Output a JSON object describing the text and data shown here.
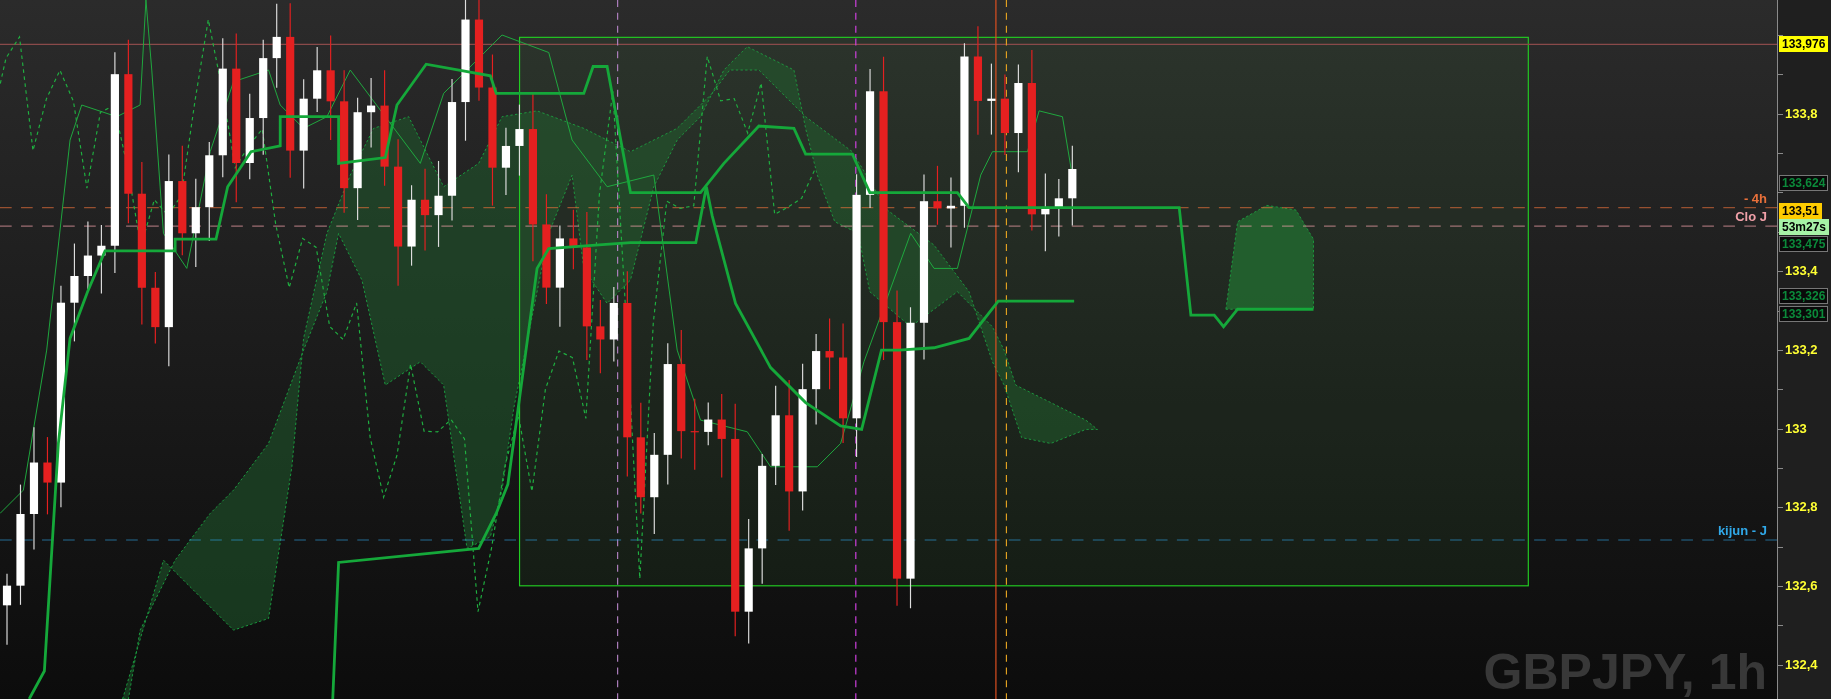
{
  "chart": {
    "symbol": "GBPJPY, 1h",
    "axis_labels": [
      "133,8",
      "133,4",
      "133,2",
      "133",
      "132,8",
      "132,6",
      "132,4"
    ],
    "price_tags": [
      {
        "kind": "filled",
        "label": "133,976",
        "color": "#ffff00"
      },
      {
        "kind": "outlined",
        "label": "133,624",
        "color": "#0b8a3a"
      },
      {
        "kind": "filled",
        "label": "133,51",
        "color": "#ffcc00"
      },
      {
        "kind": "filled",
        "label": "53m27s",
        "color": "#a6f2a6"
      },
      {
        "kind": "outlined",
        "label": "133,475",
        "color": "#0b8a3a"
      },
      {
        "kind": "outlined",
        "label": "133,326",
        "color": "#0b8a3a"
      },
      {
        "kind": "outlined",
        "label": "133,301",
        "color": "#0b8a3a"
      }
    ],
    "line_labels": [
      {
        "label": "- 4h",
        "color": "#e8703a"
      },
      {
        "label": "Clo J",
        "color": "#f0a0a8"
      },
      {
        "label": "kijun - J",
        "color": "#30a8e8"
      }
    ]
  }
}
